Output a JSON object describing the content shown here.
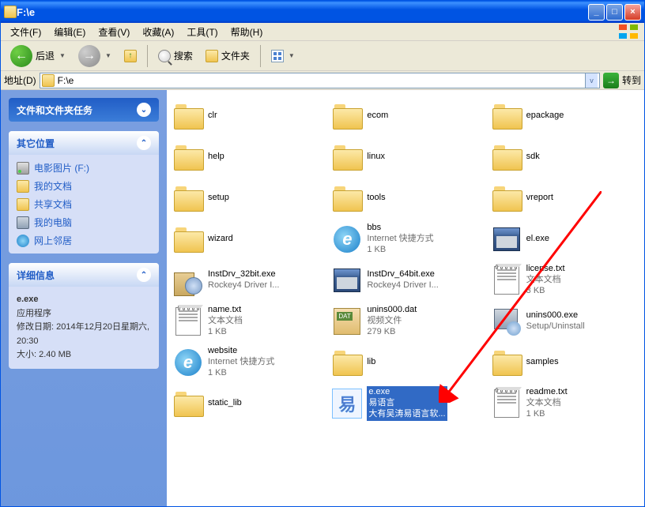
{
  "title": "F:\\e",
  "menu": {
    "file": "文件(F)",
    "edit": "编辑(E)",
    "view": "查看(V)",
    "fav": "收藏(A)",
    "tools": "工具(T)",
    "help": "帮助(H)"
  },
  "toolbar": {
    "back": "后退",
    "search": "搜索",
    "folders": "文件夹"
  },
  "addressbar": {
    "label": "地址(D)",
    "path": "F:\\e",
    "go": "转到"
  },
  "tasks": {
    "filetasks": "文件和文件夹任务",
    "otherplaces": "其它位置",
    "links": {
      "drive": "电影图片 (F:)",
      "mydocs": "我的文档",
      "shared": "共享文档",
      "mycomputer": "我的电脑",
      "network": "网上邻居"
    },
    "details": "详细信息",
    "detail": {
      "name": "e.exe",
      "type": "应用程序",
      "modlabel": "修改日期: 2014年12月20日星期六, 20:30",
      "sizelabel": "大小: 2.40 MB"
    }
  },
  "items": [
    {
      "name": "clr",
      "icon": "folder"
    },
    {
      "name": "ecom",
      "icon": "folder"
    },
    {
      "name": "epackage",
      "icon": "folder"
    },
    {
      "name": "help",
      "icon": "folder"
    },
    {
      "name": "linux",
      "icon": "folder"
    },
    {
      "name": "sdk",
      "icon": "folder"
    },
    {
      "name": "setup",
      "icon": "folder"
    },
    {
      "name": "tools",
      "icon": "folder"
    },
    {
      "name": "vreport",
      "icon": "folder"
    },
    {
      "name": "wizard",
      "icon": "folder"
    },
    {
      "name": "bbs",
      "l2": "Internet 快捷方式",
      "l3": "1 KB",
      "icon": "ie"
    },
    {
      "name": "el.exe",
      "icon": "exe"
    },
    {
      "name": "InstDrv_32bit.exe",
      "l2": "Rockey4 Driver I...",
      "icon": "install"
    },
    {
      "name": "InstDrv_64bit.exe",
      "l2": "Rockey4 Driver I...",
      "icon": "exe"
    },
    {
      "name": "license.txt",
      "l2": "文本文档",
      "l3": "3 KB",
      "icon": "txt"
    },
    {
      "name": "name.txt",
      "l2": "文本文档",
      "l3": "1 KB",
      "icon": "txt"
    },
    {
      "name": "unins000.dat",
      "l2": "视频文件",
      "l3": "279 KB",
      "icon": "dat"
    },
    {
      "name": "unins000.exe",
      "l2": "Setup/Uninstall",
      "icon": "setup"
    },
    {
      "name": "website",
      "l2": "Internet 快捷方式",
      "l3": "1 KB",
      "icon": "ie"
    },
    {
      "name": "lib",
      "icon": "folder"
    },
    {
      "name": "samples",
      "icon": "folder"
    },
    {
      "name": "static_lib",
      "icon": "folder"
    },
    {
      "name": "e.exe",
      "l2": "易语言",
      "l3": "大有吴涛易语言软...",
      "icon": "e",
      "selected": true
    },
    {
      "name": "readme.txt",
      "l2": "文本文档",
      "l3": "1 KB",
      "icon": "txt"
    }
  ]
}
